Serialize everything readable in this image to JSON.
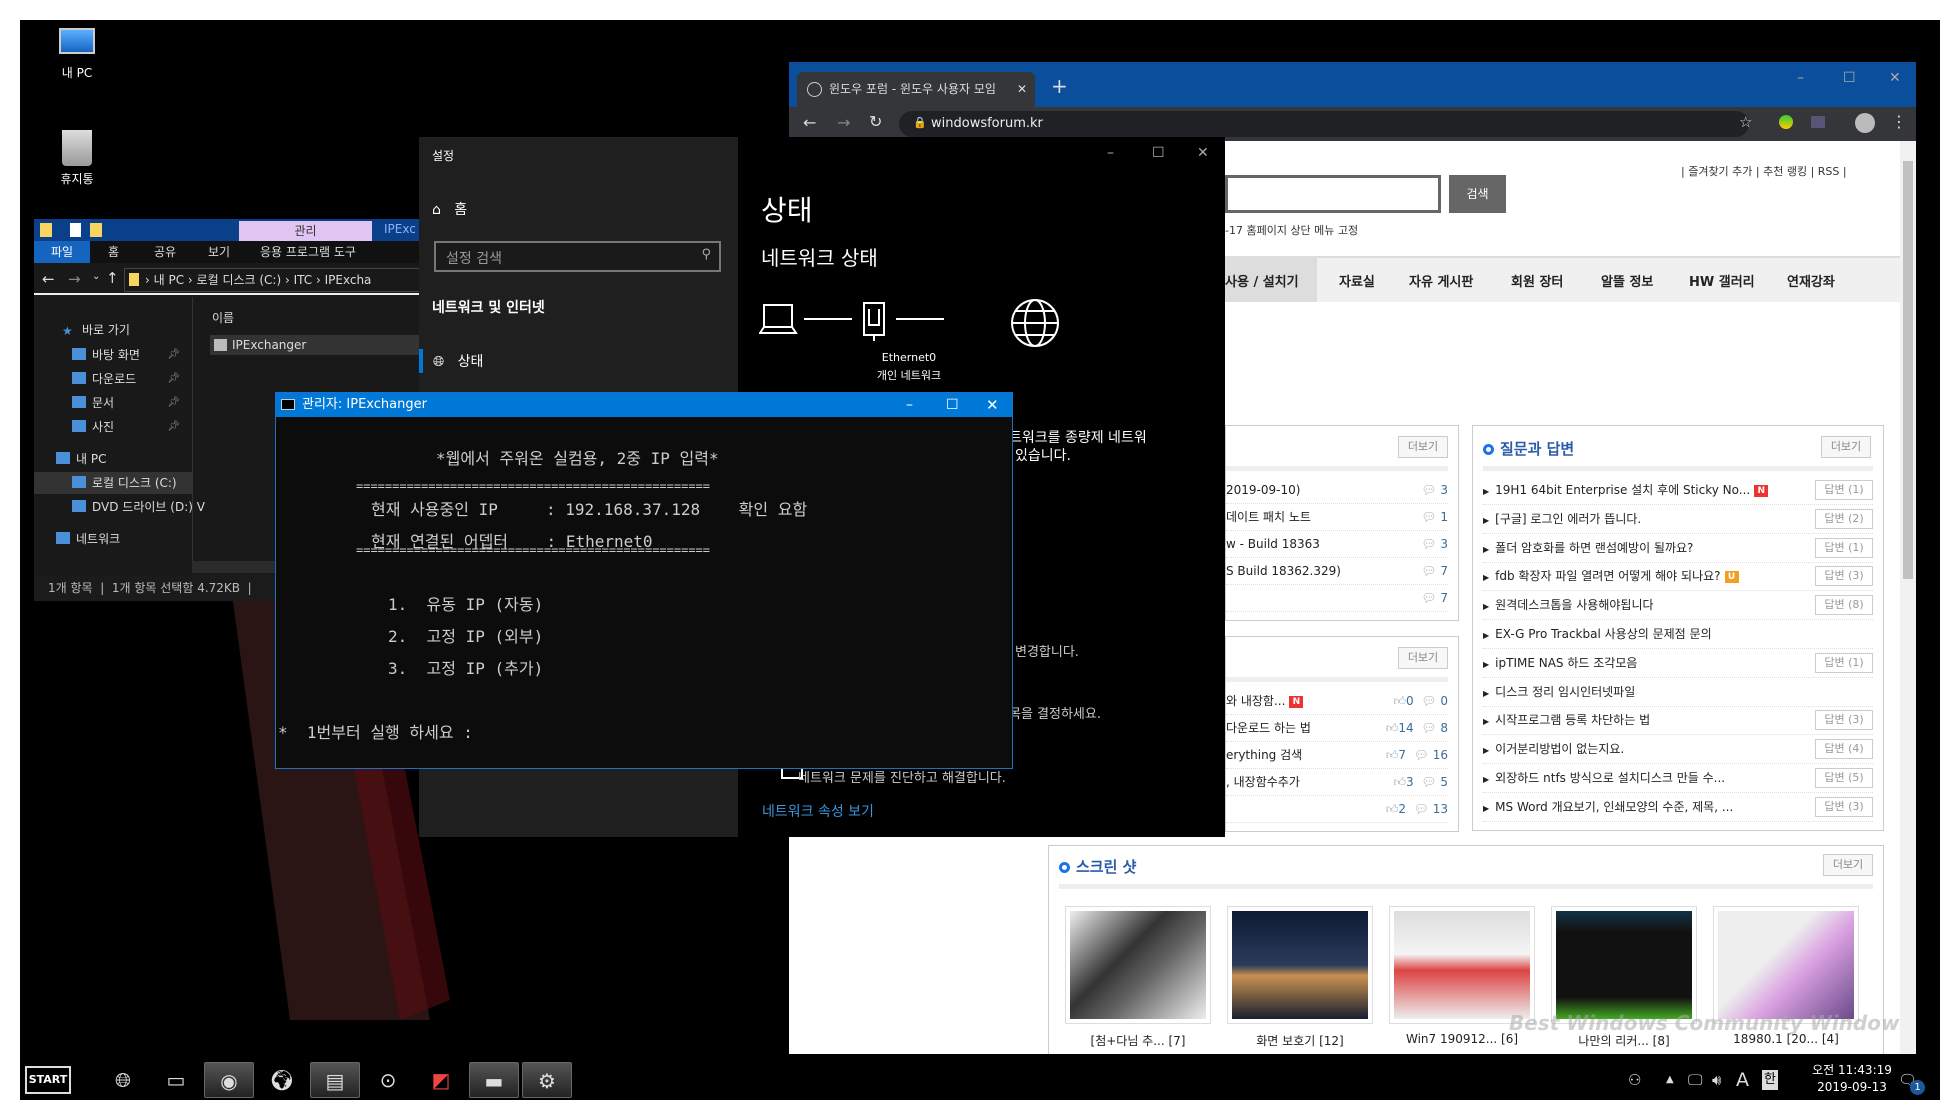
{
  "desktop": {
    "icons": [
      {
        "label": "내 PC",
        "icon": "computer-icon"
      },
      {
        "label": "휴지통",
        "icon": "recycle-bin-icon"
      }
    ]
  },
  "explorer": {
    "ribbon_context": "관리",
    "title_partial": "IPExc",
    "tabs": [
      "파일",
      "홈",
      "공유",
      "보기",
      "응용 프로그램 도구"
    ],
    "breadcrumb": [
      "내 PC",
      "로컬 디스크 (C:)",
      "ITC",
      "IPExcha"
    ],
    "column_header": "이름",
    "files": [
      "IPExchanger"
    ],
    "nav": [
      {
        "label": "바로 가기"
      },
      {
        "label": "바탕 화면",
        "pinned": true
      },
      {
        "label": "다운로드",
        "pinned": true
      },
      {
        "label": "문서",
        "pinned": true
      },
      {
        "label": "사진",
        "pinned": true
      },
      {
        "label": "내 PC"
      },
      {
        "label": "로컬 디스크 (C:)",
        "selected": true
      },
      {
        "label": "DVD 드라이브 (D:) V"
      },
      {
        "label": "네트워크"
      }
    ],
    "status": "1개 항목  |  1개 항목 선택함 4.72KB  |"
  },
  "settings": {
    "title": "설정",
    "home": "홈",
    "search_placeholder": "설정 검색",
    "category": "네트워크 및 인터넷",
    "nav_selected": "상태",
    "page_title": "상태",
    "section_title": "네트워크 상태",
    "adapter": "Ethernet0",
    "network_type": "개인 네트워크",
    "text1": "트워크를 종량제 네트워",
    "text2": "있습니다.",
    "text3": "변경합니다.",
    "text4": "목을 결정하세요.",
    "text5": "네트워크 문제를 진단하고 해결합니다.",
    "link": "네트워크 속성 보기"
  },
  "cmd": {
    "title": "관리자:  IPExchanger",
    "heading": "*웹에서 주워온 실컴용, 2중 IP 입력*",
    "separator": "=================================================",
    "ip_line": "현재 사용중인 IP     : 192.168.37.128    확인 요함",
    "adapter_line": "현재 연결된 어뎁터    : Ethernet0",
    "options": [
      "1.  유동 IP (자동)",
      "2.  고정 IP (외부)",
      "3.  고정 IP (추가)"
    ],
    "prompt": "*  1번부터 실행 하세요 :"
  },
  "browser": {
    "tab_title": "윈도우 포럼 - 윈도우 사용자 모임",
    "url": "windowsforum.kr",
    "search_button": "검색",
    "top_links": "| 즐겨찾기 추가 | 추천 랭킹 | RSS |",
    "notice": "-17 홈페이지 상단 메뉴 고정",
    "nav": [
      "사용 / 설치기",
      "자료실",
      "자유 게시판",
      "회원 장터",
      "알뜰 정보",
      "HW 갤러리",
      "연재강좌"
    ],
    "more_label": "더보기",
    "box1": [
      {
        "t": "2019-09-10)",
        "c": "3"
      },
      {
        "t": "데이트 패치 노트",
        "c": "1"
      },
      {
        "t": "w - Build 18363",
        "c": "3"
      },
      {
        "t": "S Build 18362.329)",
        "c": "7"
      },
      {
        "t": "",
        "c": "7"
      }
    ],
    "box2": [
      {
        "t": "와 내장함...",
        "l": "0",
        "c": "0",
        "new": true
      },
      {
        "t": "다운로드 하는 법",
        "l": "14",
        "c": "8"
      },
      {
        "t": "erything 검색",
        "l": "7",
        "c": "16"
      },
      {
        "t": ", 내장함수추가",
        "l": "3",
        "c": "5"
      },
      {
        "t": "",
        "l": "2",
        "c": "13"
      }
    ],
    "qa_title": "질문과 답변",
    "qa": [
      {
        "t": "19H1 64bit Enterprise 설치 후에 Sticky No...",
        "a": "답변 (1)",
        "badge": "N"
      },
      {
        "t": "[구글] 로그인 에러가 뜹니다.",
        "a": "답변 (2)"
      },
      {
        "t": "폴더 암호화를 하면 랜섬예방이 될까요?",
        "a": "답변 (1)"
      },
      {
        "t": "fdb 확장자 파일 열려면 어떻게 해야 되나요?",
        "a": "답변 (3)",
        "badge": "U"
      },
      {
        "t": "원격데스크톱을 사용해야됩니다",
        "a": "답변 (8)"
      },
      {
        "t": "EX-G Pro Trackbal 사용상의 문제점 문의",
        "a": ""
      },
      {
        "t": "ipTIME NAS 하드 조각모음",
        "a": "답변 (1)"
      },
      {
        "t": "디스크 정리 임시인터넷파일",
        "a": ""
      },
      {
        "t": "시작프로그램 등록 차단하는 법",
        "a": "답변 (3)"
      },
      {
        "t": "이거분리방법이 없는지요.",
        "a": "답변 (4)"
      },
      {
        "t": "외장하드 ntfs 방식으로 설치디스크 만들 수...",
        "a": "답변 (5)"
      },
      {
        "t": "MS Word 개요보기, 인쇄모양의 수준, 제목, ...",
        "a": "답변 (3)"
      }
    ],
    "screens_title": "스크린 샷",
    "screens": [
      "[첨+다님 추... [7]",
      "화면 보호기 [12]",
      "Win7 190912... [6]",
      "나만의 리커... [8]",
      "18980.1 [20... [4]"
    ],
    "watermark": "Best Windows Community  Windows Forum"
  },
  "taskbar": {
    "start": "START",
    "apps": [
      {
        "icon": "network-globe-icon"
      },
      {
        "icon": "clipboard-icon"
      },
      {
        "icon": "chrome-icon",
        "active": true
      },
      {
        "icon": "earth-icon"
      },
      {
        "icon": "file-explorer-icon",
        "active": true
      },
      {
        "icon": "media-player-icon"
      },
      {
        "icon": "app-icon"
      },
      {
        "icon": "cmd-icon",
        "active": true
      },
      {
        "icon": "settings-gear-icon",
        "active": true
      }
    ],
    "ime_a": "A",
    "ime_han": "한",
    "time": "오전 11:43:19",
    "date": "2019-09-13",
    "notifications": "1"
  },
  "colors": {
    "cmd_title": "#0078d7",
    "browser_title": "#0b4f9c",
    "settings_accent": "#0078d7",
    "link": "#3a96dd"
  }
}
